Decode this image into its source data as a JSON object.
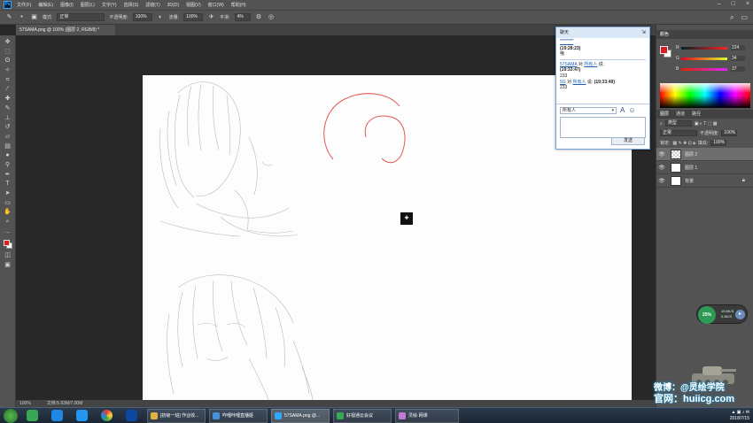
{
  "menubar": {
    "items": [
      "文件(F)",
      "编辑(E)",
      "图像(I)",
      "图层(L)",
      "文字(Y)",
      "选择(S)",
      "滤镜(T)",
      "3D(D)",
      "视图(V)",
      "窗口(W)",
      "帮助(H)"
    ]
  },
  "options": {
    "mode_label": "模式:",
    "mode_value": "正常",
    "opacity_label": "不透明度:",
    "opacity_value": "100%",
    "flow_label": "流量:",
    "flow_value": "100%",
    "smooth_label": "平滑:",
    "smooth_value": "4%"
  },
  "document": {
    "tab_title": "57SAMA.png @ 100% (图层 2, RGB/8) *",
    "status_zoom": "100%",
    "status_doc": "文档:5.93M/7.00M"
  },
  "chat": {
    "title": "聊天",
    "messages": [
      {
        "sender": "",
        "verb": "",
        "to": "",
        "time": "(19:28:23)",
        "text": "哦"
      },
      {
        "sender": "57SAMA",
        "verb": "对",
        "to": "所有人",
        "said": "说:",
        "time": "(19:33:47)",
        "text": "233"
      },
      {
        "sender": "5G",
        "verb": "对",
        "to": "所有人",
        "said": "说:",
        "time": "(19:33:49)",
        "text": "233"
      }
    ],
    "recipient": "所有人",
    "send_label": "发送"
  },
  "color_panel": {
    "tab": "颜色",
    "r_label": "R",
    "r_value": "224",
    "g_label": "G",
    "g_value": "34",
    "b_label": "B",
    "b_value": "37",
    "fg_color": "#E02225"
  },
  "layers_panel": {
    "tabs": [
      "图层",
      "通道",
      "路径"
    ],
    "filter_value": "类型",
    "blend_value": "正常",
    "opacity_label": "不透明度:",
    "opacity_value": "100%",
    "lock_label": "锁定:",
    "fill_label": "填充:",
    "fill_value": "100%",
    "layers": [
      {
        "name": "图层 2",
        "selected": true,
        "transparent": true
      },
      {
        "name": "图层 1",
        "selected": false,
        "transparent": false
      },
      {
        "name": "背景",
        "selected": false,
        "transparent": false,
        "locked": true
      }
    ]
  },
  "meter": {
    "percent": "25%",
    "up": "15.8K/S",
    "down": "0.4K/S"
  },
  "watermark": {
    "line1": "微博：@灵绘学院",
    "line2": "官网：huiicg.com"
  },
  "taskbar": {
    "apps": [
      "[初级一班] 作业收...",
      "咋哩咔哩直播姬",
      "57SAMA.png @...",
      "好视通云会议",
      "灵绘·网课"
    ],
    "date": "2018/7/15"
  }
}
